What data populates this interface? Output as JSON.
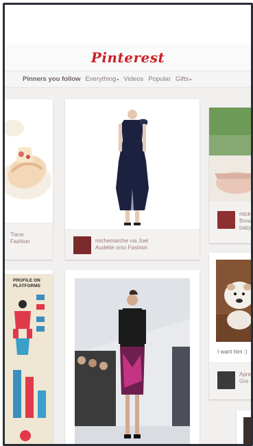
{
  "header": {
    "logo_text": "Pinterest",
    "brand_color": "#cb2027"
  },
  "nav": {
    "items": [
      {
        "label": "Pinners you follow",
        "dropdown": false
      },
      {
        "label": "Everything",
        "dropdown": true
      },
      {
        "label": "Videos",
        "dropdown": false
      },
      {
        "label": "Popular",
        "dropdown": false
      },
      {
        "label": "Gifts",
        "dropdown": true
      }
    ],
    "caret_glyph": "▾"
  },
  "pins": {
    "left_top": {
      "text": "Tiane",
      "board": "Fashion"
    },
    "center_top": {
      "user": "michemarche",
      "via_word": "via",
      "via_user": "Joel",
      "line2": "Audette",
      "onto_word": "onto",
      "board": "Fashion"
    },
    "right_top": {
      "line1": "micki",
      "line2": "Brea",
      "line3": "baby"
    },
    "left_bottom": {
      "heading_l1": "PROFILE ON",
      "heading_l2": "PLATFORMS"
    },
    "right_bottom": {
      "caption": "I want him :)",
      "line1": "Apre",
      "line2": "Gre"
    }
  }
}
